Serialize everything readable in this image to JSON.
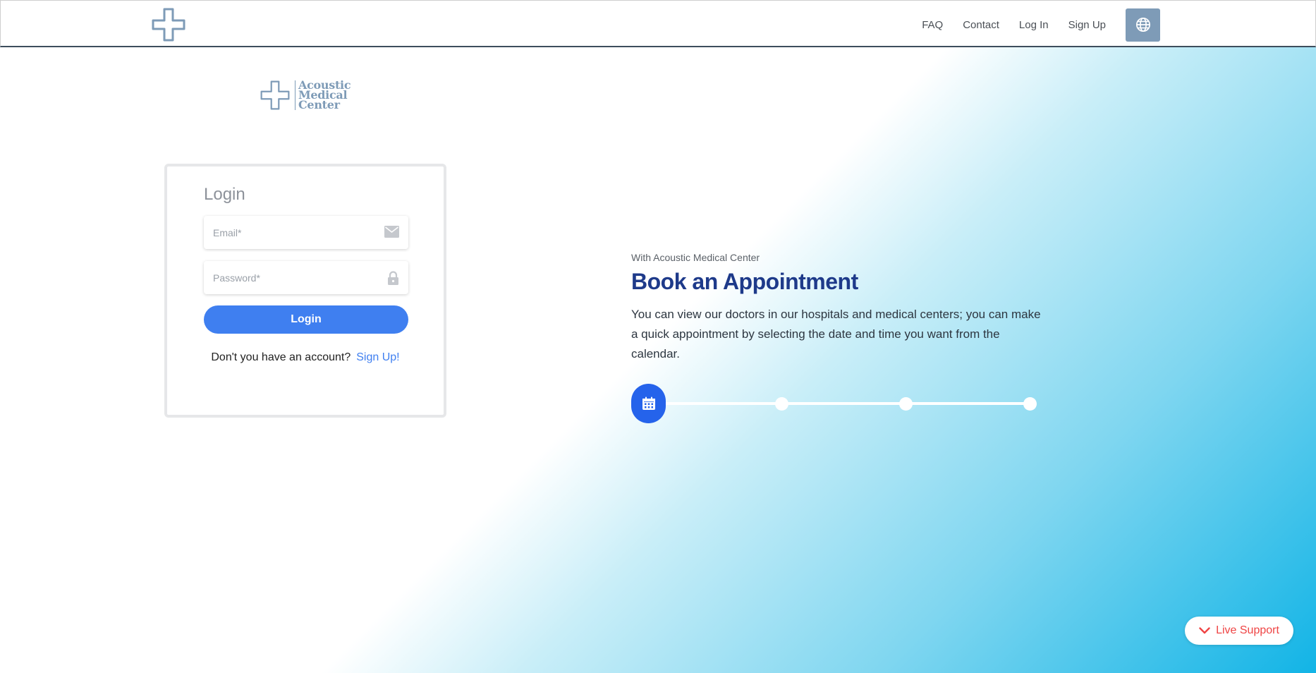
{
  "header": {
    "nav": [
      "FAQ",
      "Contact",
      "Log In",
      "Sign Up"
    ],
    "lang_icon": "globe-icon",
    "logo_icon": "medical-cross-icon"
  },
  "brand": {
    "line1": "Acoustic",
    "line2": "Medical",
    "line3": "Center"
  },
  "login": {
    "title": "Login",
    "email_placeholder": "Email*",
    "password_placeholder": "Password*",
    "button": "Login",
    "no_account_text": "Don't you have an account?",
    "signup_link": "Sign Up!"
  },
  "hero": {
    "subtitle": "With Acoustic Medical Center",
    "title": "Book an Appointment",
    "description": "You can view our doctors in our hospitals and medical centers; you can make a quick appointment by selecting the date and time you want from the calendar."
  },
  "steps": {
    "count": 4,
    "active": 1,
    "active_icon": "calendar-icon"
  },
  "live_support": {
    "label": "Live Support",
    "icon": "chevron-down-icon"
  },
  "colors": {
    "accent": "#3f7ff0",
    "title": "#1e3a8a",
    "brand": "#7e9bb7",
    "support": "#ef4444",
    "gradient_end": "#12b4e6"
  }
}
